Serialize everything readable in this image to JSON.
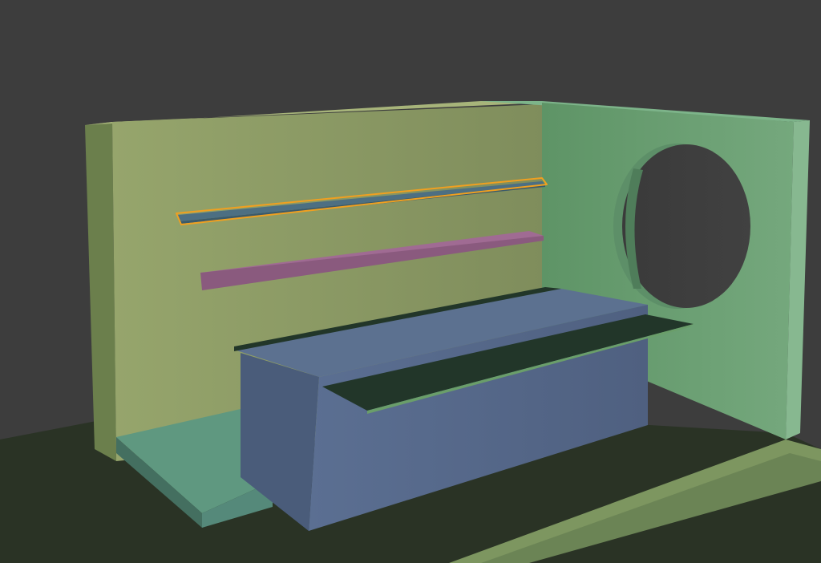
{
  "viewport": {
    "background": "#3d3d3d",
    "selection_outline_color": "#f0a020"
  },
  "scene": {
    "objects": [
      {
        "name": "ground-floor",
        "color": "#2a3325"
      },
      {
        "name": "back-wall",
        "color": "#8c9a64"
      },
      {
        "name": "right-wall",
        "color": "#6a9e78"
      },
      {
        "name": "round-window-hole",
        "color": "#3d3d3d"
      },
      {
        "name": "upper-shelf",
        "color": "#4d6f82",
        "selected": true
      },
      {
        "name": "lower-shelf",
        "color": "#8a5a7e"
      },
      {
        "name": "counter-block",
        "color": "#56698a"
      },
      {
        "name": "counter-top-strip",
        "color": "#223629"
      },
      {
        "name": "floor-step",
        "color": "#5f9880"
      },
      {
        "name": "floor-slab-edge",
        "color": "#7d9660"
      }
    ]
  }
}
